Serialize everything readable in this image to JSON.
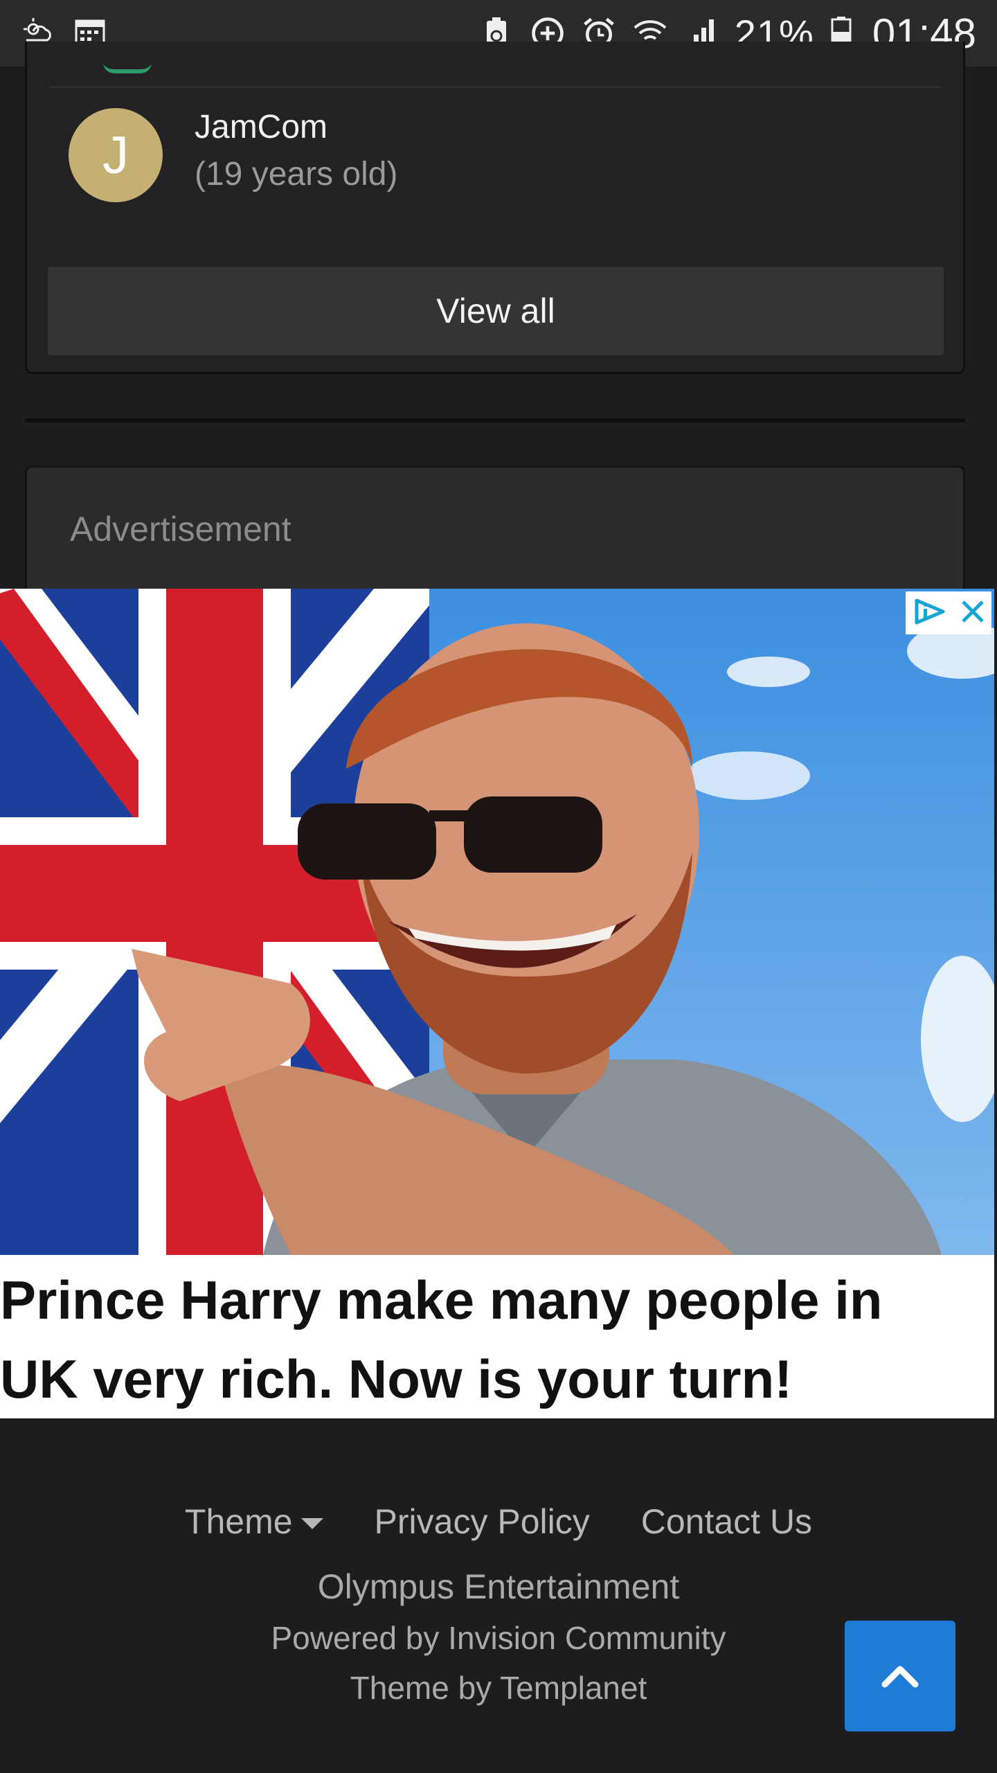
{
  "status_bar": {
    "battery_percent": "21%",
    "time": "01:48",
    "icons": [
      "weather-icon",
      "calendar-icon",
      "battery-saver-icon",
      "data-saver-icon",
      "alarm-icon",
      "wifi-icon",
      "signal-icon",
      "battery-icon"
    ]
  },
  "members": {
    "items": [
      {
        "initial": "J",
        "name": "JamCom",
        "age": "(19 years old)",
        "avatar_color": "#c4b072"
      }
    ],
    "view_all_label": "View all"
  },
  "advertisement": {
    "label": "Advertisement",
    "caption_line1": "Prince Harry make many people in",
    "caption_line2": "UK very rich. Now is your turn!"
  },
  "footer": {
    "theme_label": "Theme",
    "privacy_label": "Privacy Policy",
    "contact_label": "Contact Us",
    "company": "Olympus Entertainment",
    "powered_by": "Powered by Invision Community",
    "theme_by": "Theme by Templanet"
  },
  "colors": {
    "background": "#1d1d1f",
    "accent": "#1e7bd6",
    "avatar": "#c4b072"
  }
}
